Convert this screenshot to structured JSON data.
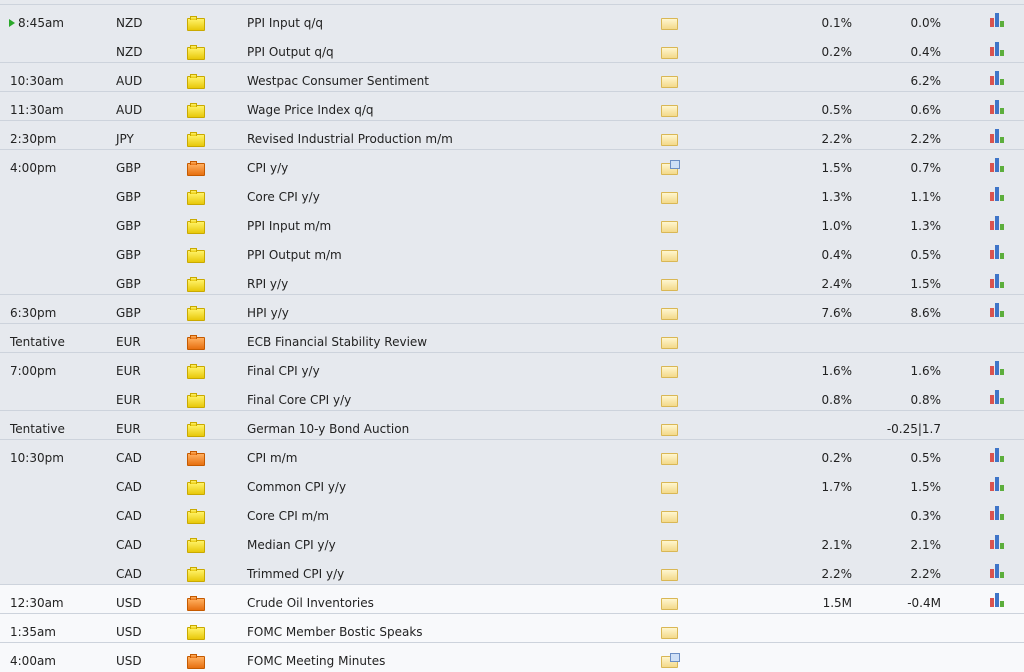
{
  "colors": {
    "low_impact": "#f2d21c",
    "high_impact": "#ef7f20",
    "chart_red": "#d9534f",
    "chart_blue": "#3f75c8",
    "chart_green": "#5cae3c"
  },
  "icons": {
    "impact": "flag-icon",
    "details": "folder-icon",
    "report": "report-icon",
    "history": "bar-chart-icon",
    "current": "play-arrow-icon"
  },
  "groups": [
    {
      "time": "8:45am",
      "current": true,
      "rows": [
        {
          "currency": "NZD",
          "impact": "low",
          "event": "PPI Input q/q",
          "report": false,
          "forecast": "0.1%",
          "previous": "0.0%",
          "chart": true
        },
        {
          "currency": "NZD",
          "impact": "low",
          "event": "PPI Output q/q",
          "report": false,
          "forecast": "0.2%",
          "previous": "0.4%",
          "chart": true
        }
      ]
    },
    {
      "time": "10:30am",
      "rows": [
        {
          "currency": "AUD",
          "impact": "low",
          "event": "Westpac Consumer Sentiment",
          "report": false,
          "forecast": "",
          "previous": "6.2%",
          "chart": true
        }
      ]
    },
    {
      "time": "11:30am",
      "rows": [
        {
          "currency": "AUD",
          "impact": "low",
          "event": "Wage Price Index q/q",
          "report": false,
          "forecast": "0.5%",
          "previous": "0.6%",
          "chart": true
        }
      ]
    },
    {
      "time": "2:30pm",
      "rows": [
        {
          "currency": "JPY",
          "impact": "low",
          "event": "Revised Industrial Production m/m",
          "report": false,
          "forecast": "2.2%",
          "previous": "2.2%",
          "chart": true
        }
      ]
    },
    {
      "time": "4:00pm",
      "rows": [
        {
          "currency": "GBP",
          "impact": "high",
          "event": "CPI y/y",
          "report": true,
          "forecast": "1.5%",
          "previous": "0.7%",
          "chart": true
        },
        {
          "currency": "GBP",
          "impact": "low",
          "event": "Core CPI y/y",
          "report": false,
          "forecast": "1.3%",
          "previous": "1.1%",
          "chart": true
        },
        {
          "currency": "GBP",
          "impact": "low",
          "event": "PPI Input m/m",
          "report": false,
          "forecast": "1.0%",
          "previous": "1.3%",
          "chart": true
        },
        {
          "currency": "GBP",
          "impact": "low",
          "event": "PPI Output m/m",
          "report": false,
          "forecast": "0.4%",
          "previous": "0.5%",
          "chart": true
        },
        {
          "currency": "GBP",
          "impact": "low",
          "event": "RPI y/y",
          "report": false,
          "forecast": "2.4%",
          "previous": "1.5%",
          "chart": true
        }
      ]
    },
    {
      "time": "6:30pm",
      "rows": [
        {
          "currency": "GBP",
          "impact": "low",
          "event": "HPI y/y",
          "report": false,
          "forecast": "7.6%",
          "previous": "8.6%",
          "chart": true
        }
      ]
    },
    {
      "time": "Tentative",
      "rows": [
        {
          "currency": "EUR",
          "impact": "high",
          "event": "ECB Financial Stability Review",
          "report": false,
          "forecast": "",
          "previous": "",
          "chart": false
        }
      ]
    },
    {
      "time": "7:00pm",
      "rows": [
        {
          "currency": "EUR",
          "impact": "low",
          "event": "Final CPI y/y",
          "report": false,
          "forecast": "1.6%",
          "previous": "1.6%",
          "chart": true
        },
        {
          "currency": "EUR",
          "impact": "low",
          "event": "Final Core CPI y/y",
          "report": false,
          "forecast": "0.8%",
          "previous": "0.8%",
          "chart": true
        }
      ]
    },
    {
      "time": "Tentative",
      "rows": [
        {
          "currency": "EUR",
          "impact": "low",
          "event": "German 10-y Bond Auction",
          "report": false,
          "forecast": "",
          "previous": "-0.25|1.7",
          "chart": false
        }
      ]
    },
    {
      "time": "10:30pm",
      "rows": [
        {
          "currency": "CAD",
          "impact": "high",
          "event": "CPI m/m",
          "report": false,
          "forecast": "0.2%",
          "previous": "0.5%",
          "chart": true
        },
        {
          "currency": "CAD",
          "impact": "low",
          "event": "Common CPI y/y",
          "report": false,
          "forecast": "1.7%",
          "previous": "1.5%",
          "chart": true
        },
        {
          "currency": "CAD",
          "impact": "low",
          "event": "Core CPI m/m",
          "report": false,
          "forecast": "",
          "previous": "0.3%",
          "chart": true
        },
        {
          "currency": "CAD",
          "impact": "low",
          "event": "Median CPI y/y",
          "report": false,
          "forecast": "2.1%",
          "previous": "2.1%",
          "chart": true
        },
        {
          "currency": "CAD",
          "impact": "low",
          "event": "Trimmed CPI y/y",
          "report": false,
          "forecast": "2.2%",
          "previous": "2.2%",
          "chart": true
        }
      ]
    },
    {
      "time": "12:30am",
      "rows": [
        {
          "currency": "USD",
          "impact": "high",
          "event": "Crude Oil Inventories",
          "report": false,
          "forecast": "1.5M",
          "previous": "-0.4M",
          "chart": true
        }
      ]
    },
    {
      "time": "1:35am",
      "rows": [
        {
          "currency": "USD",
          "impact": "low",
          "event": "FOMC Member Bostic Speaks",
          "report": false,
          "forecast": "",
          "previous": "",
          "chart": false
        }
      ]
    },
    {
      "time": "4:00am",
      "rows": [
        {
          "currency": "USD",
          "impact": "high",
          "event": "FOMC Meeting Minutes",
          "report": true,
          "forecast": "",
          "previous": "",
          "chart": false
        }
      ]
    }
  ]
}
